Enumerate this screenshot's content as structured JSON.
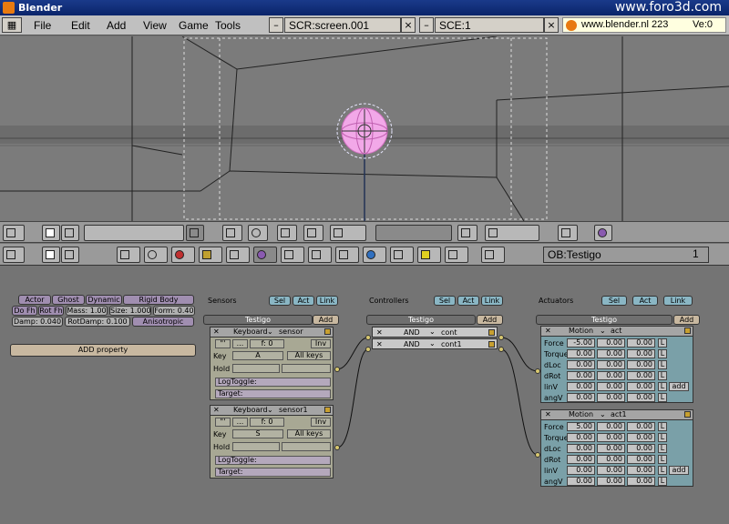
{
  "window": {
    "title": "Blender",
    "watermark": "www.foro3d.com"
  },
  "menu": [
    "File",
    "Edit",
    "Add",
    "View",
    "Game",
    "Tools"
  ],
  "screen_field": "SCR:screen.001",
  "scene_field": "SCE:1",
  "url_field": "www.blender.nl  223",
  "version": "Ve:0",
  "object": {
    "name": "OB:Testigo",
    "layer": "1"
  },
  "physics": {
    "row1": [
      "Actor",
      "Ghost",
      "Dynamic",
      "Rigid Body"
    ],
    "row2": [
      "Do Fh",
      "Rot Fh",
      "Mass: 1.00",
      "Size: 1.000",
      "Form: 0.40"
    ],
    "row3": [
      "Damp: 0.040",
      "RotDamp: 0.100",
      "Anisotropic"
    ],
    "add_property": "ADD property"
  },
  "sensors": {
    "title": "Sensors",
    "tabs": [
      "Sel",
      "Act",
      "Link"
    ],
    "object": "Testigo",
    "add": "Add",
    "items": [
      {
        "type": "Keyboard",
        "name": "sensor",
        "freq": "f: 0",
        "inv": "Inv",
        "key_label": "Key",
        "key": "A",
        "allkeys": "All keys",
        "hold": "Hold",
        "logtoggle": "LogToggle:",
        "target": "Target:"
      },
      {
        "type": "Keyboard",
        "name": "sensor1",
        "freq": "f: 0",
        "inv": "Inv",
        "key_label": "Key",
        "key": "S",
        "allkeys": "All keys",
        "hold": "Hold",
        "logtoggle": "LogToggle:",
        "target": "Target:"
      }
    ]
  },
  "controllers": {
    "title": "Controllers",
    "tabs": [
      "Sel",
      "Act",
      "Link"
    ],
    "object": "Testigo",
    "add": "Add",
    "items": [
      {
        "type": "AND",
        "name": "cont"
      },
      {
        "type": "AND",
        "name": "cont1"
      }
    ]
  },
  "actuators": {
    "title": "Actuators",
    "tabs": [
      "Sel",
      "Act",
      "Link"
    ],
    "object": "Testigo",
    "add": "Add",
    "items": [
      {
        "type": "Motion",
        "name": "act",
        "rows": [
          {
            "label": "Force",
            "v": [
              "-5.00",
              "0.00",
              "0.00"
            ],
            "flag": "L"
          },
          {
            "label": "Torque",
            "v": [
              "0.00",
              "0.00",
              "0.00"
            ],
            "flag": "L"
          },
          {
            "label": "dLoc",
            "v": [
              "0.00",
              "0.00",
              "0.00"
            ],
            "flag": "L"
          },
          {
            "label": "dRot",
            "v": [
              "0.00",
              "0.00",
              "0.00"
            ],
            "flag": "L"
          },
          {
            "label": "linV",
            "v": [
              "0.00",
              "0.00",
              "0.00"
            ],
            "flag": "L",
            "extra": "add"
          },
          {
            "label": "angV",
            "v": [
              "0.00",
              "0.00",
              "0.00"
            ],
            "flag": "L"
          }
        ]
      },
      {
        "type": "Motion",
        "name": "act1",
        "rows": [
          {
            "label": "Force",
            "v": [
              "5.00",
              "0.00",
              "0.00"
            ],
            "flag": "L"
          },
          {
            "label": "Torque",
            "v": [
              "0.00",
              "0.00",
              "0.00"
            ],
            "flag": "L"
          },
          {
            "label": "dLoc",
            "v": [
              "0.00",
              "0.00",
              "0.00"
            ],
            "flag": "L"
          },
          {
            "label": "dRot",
            "v": [
              "0.00",
              "0.00",
              "0.00"
            ],
            "flag": "L"
          },
          {
            "label": "linV",
            "v": [
              "0.00",
              "0.00",
              "0.00"
            ],
            "flag": "L",
            "extra": "add"
          },
          {
            "label": "angV",
            "v": [
              "0.00",
              "0.00",
              "0.00"
            ],
            "flag": "L"
          }
        ]
      }
    ]
  }
}
